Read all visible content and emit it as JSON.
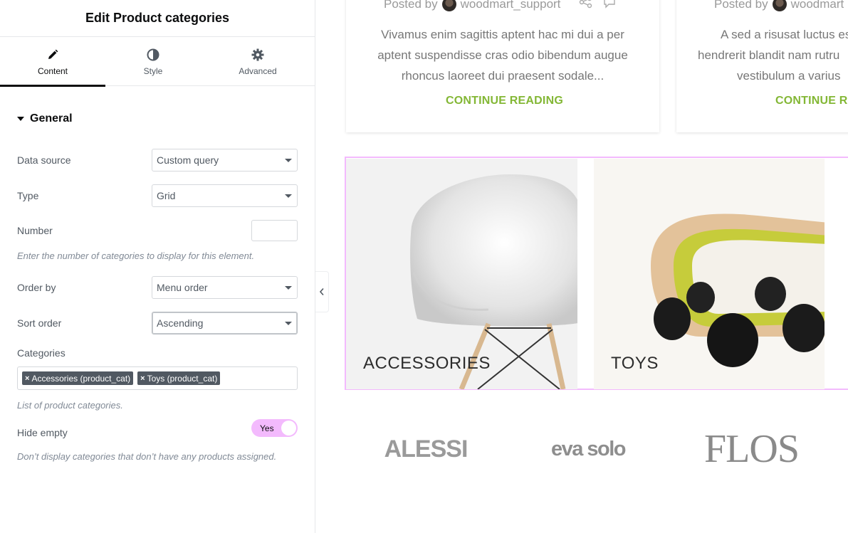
{
  "editor": {
    "title": "Edit Product categories",
    "tabs": [
      {
        "label": "Content",
        "icon": "pencil-icon",
        "active": true
      },
      {
        "label": "Style",
        "icon": "half-circle-icon",
        "active": false
      },
      {
        "label": "Advanced",
        "icon": "gear-icon",
        "active": false
      }
    ],
    "section": {
      "title": "General",
      "expanded": true
    },
    "fields": {
      "data_source": {
        "label": "Data source",
        "value": "Custom query"
      },
      "type": {
        "label": "Type",
        "value": "Grid"
      },
      "number": {
        "label": "Number",
        "value": "",
        "help": "Enter the number of categories to display for this element."
      },
      "order_by": {
        "label": "Order by",
        "value": "Menu order"
      },
      "sort_order": {
        "label": "Sort order",
        "value": "Ascending"
      },
      "categories": {
        "label": "Categories",
        "tags": [
          "Accessories (product_cat)",
          "Toys (product_cat)"
        ],
        "help": "List of product categories."
      },
      "hide_empty": {
        "label": "Hide empty",
        "value": "Yes",
        "help": "Don’t display categories that don’t have any products assigned."
      }
    }
  },
  "preview": {
    "posts": [
      {
        "posted_by": "Posted by",
        "author": "woodmart_support",
        "excerpt": [
          "Vivamus enim sagittis aptent hac mi dui a per",
          "aptent suspendisse cras odio bibendum augue",
          "rhoncus laoreet dui praesent sodale..."
        ],
        "cta": "CONTINUE READING"
      },
      {
        "posted_by": "Posted by",
        "author": "woodmart",
        "excerpt": [
          "A sed a risusat luctus es",
          "hendrerit blandit nam rutru",
          "vestibulum a varius"
        ],
        "cta": "CONTINUE RI"
      }
    ],
    "categories": [
      {
        "name": "ACCESSORIES"
      },
      {
        "name": "TOYS"
      }
    ],
    "brands": [
      "ALESSI",
      "eva solo",
      "FLOS"
    ]
  },
  "colors": {
    "accent_green": "#83b735",
    "selection_pink": "#f3bafd",
    "tag_bg": "#515962"
  }
}
